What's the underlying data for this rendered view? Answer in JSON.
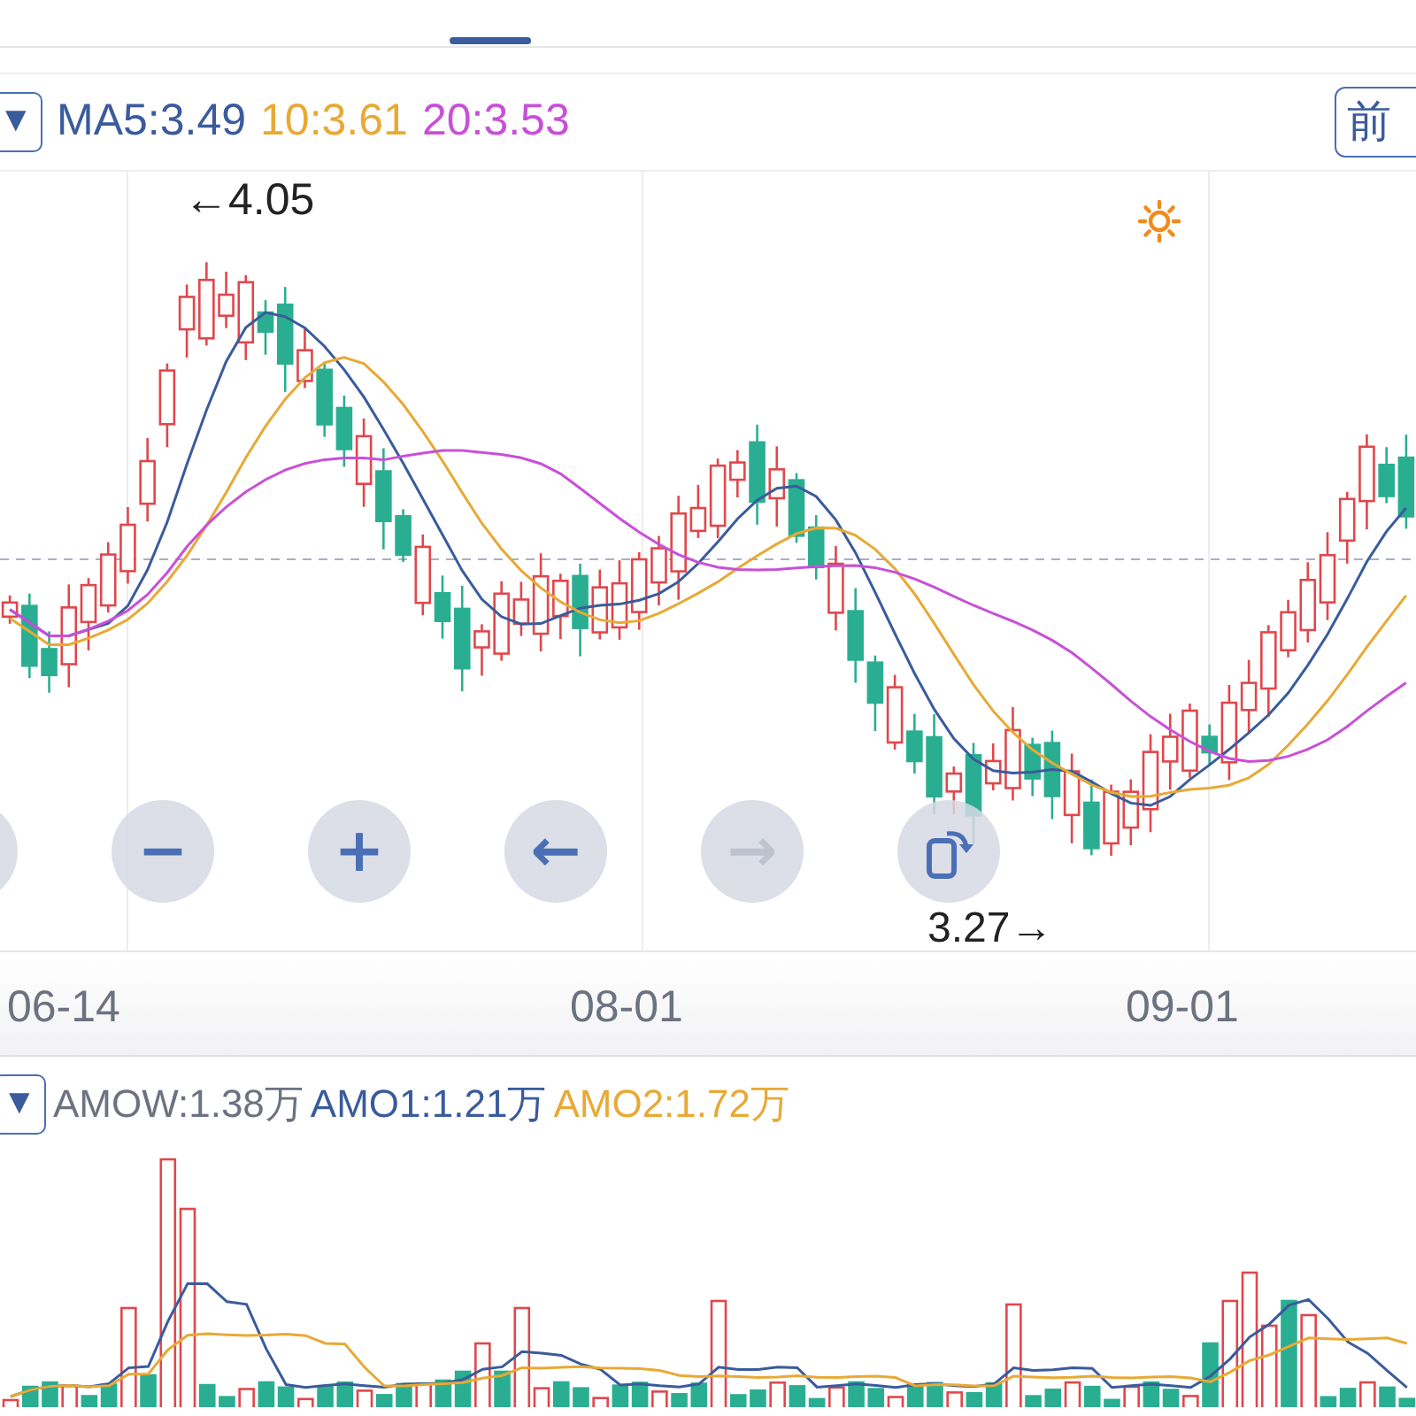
{
  "price_legend": {
    "dropdown": "▼",
    "items": [
      {
        "text": "MA5:3.49",
        "color": "#3a5b9c"
      },
      {
        "text": "10:3.61",
        "color": "#e8a935"
      },
      {
        "text": "20:3.53",
        "color": "#c850d8"
      }
    ],
    "adjust_button": "前"
  },
  "price_chart": {
    "high_label": "←4.05",
    "low_label": "3.27→",
    "controls": [
      {
        "kind": "blank"
      },
      {
        "kind": "glyph",
        "label": "−",
        "disabled": false
      },
      {
        "kind": "glyph",
        "label": "+",
        "disabled": false
      },
      {
        "kind": "glyph",
        "label": "←",
        "disabled": false
      },
      {
        "kind": "glyph",
        "label": "→",
        "disabled": true
      },
      {
        "kind": "rotate"
      }
    ]
  },
  "date_axis": [
    "06-14",
    "08-01",
    "09-01"
  ],
  "volume_legend": {
    "dropdown": "▼",
    "items": [
      {
        "text": "AMOW:1.38万",
        "color": "#6b7280"
      },
      {
        "text": "AMO1:1.21万",
        "color": "#3a5b9c"
      },
      {
        "text": "AMO2:1.72万",
        "color": "#e8a935"
      }
    ]
  }
}
